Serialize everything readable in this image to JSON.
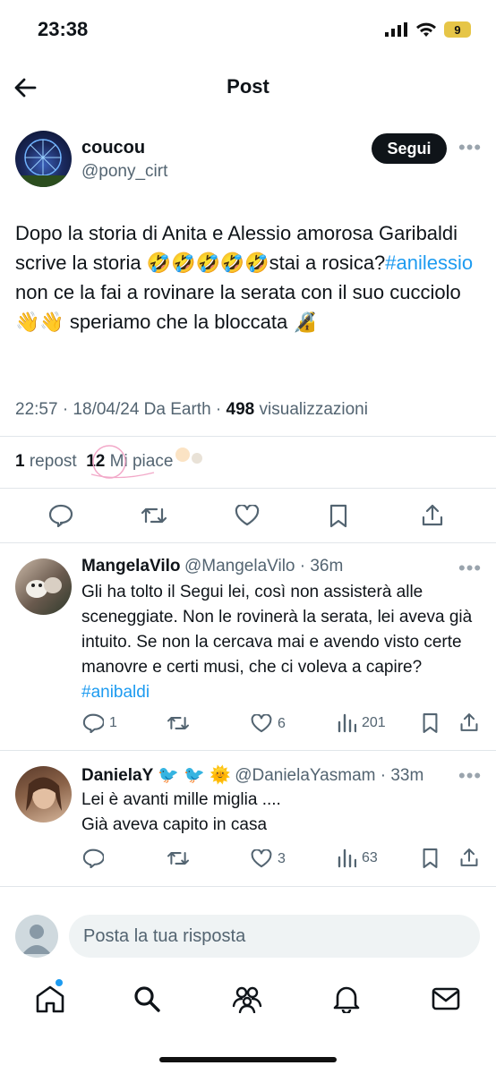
{
  "status_bar": {
    "time": "23:38",
    "battery": "9"
  },
  "header": {
    "title": "Post"
  },
  "post": {
    "author_name": "coucou",
    "author_handle": "@pony_cirt",
    "follow_label": "Segui",
    "text_1": "Dopo la storia di Anita e Alessio amorosa Garibaldi scrive la storia 🤣🤣🤣🤣🤣stai a rosica?",
    "hashtag": "#anilessio",
    "text_2": " non ce la fai a rovinare la serata con il suo cucciolo 👋👋 speriamo che la bloccata 🔏",
    "timestamp": "22:57 · 18/04/24 Da Earth · ",
    "views_count": "498",
    "views_label": " visualizzazioni",
    "reposts_count": "1",
    "reposts_label": " repost",
    "likes_count": "12",
    "likes_label": " Mi piace"
  },
  "replies": [
    {
      "name": "MangelaVilo",
      "handle": "@MangelaVilo · 36m",
      "text": "Gli ha tolto il Segui lei, così non assisterà alle sceneggiate. Non le rovinerà la serata, lei aveva già intuito. Se non la cercava mai e avendo visto certe manovre e certi musi, che ci voleva a capire? ",
      "hashtag": "#anibaldi",
      "replies": "1",
      "reposts": "",
      "likes": "6",
      "views": "201"
    },
    {
      "name": "DanielaY",
      "name_suffix": " 🐦 🐦 🌞",
      "handle": "@DanielaYasmam · 33m",
      "line1": "Lei è avanti mille miglia ....",
      "line2": "Già aveva capito in casa",
      "replies": "",
      "reposts": "",
      "likes": "3",
      "views": "63"
    }
  ],
  "composer": {
    "placeholder": "Posta la tua risposta"
  },
  "colors": {
    "accent": "#1d9bf0",
    "text": "#0f1419",
    "muted": "#536471"
  }
}
